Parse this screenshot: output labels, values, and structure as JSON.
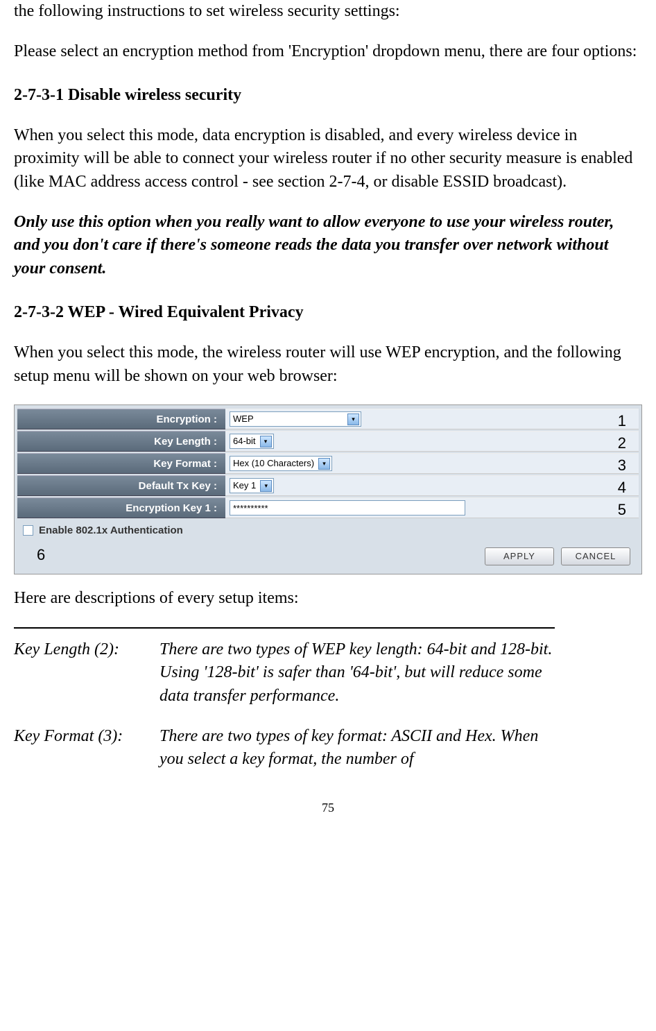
{
  "intro": {
    "line1": "the following instructions to set wireless security settings:",
    "line2": "Please select an encryption method from 'Encryption' dropdown menu, there are four options:"
  },
  "sections": {
    "s1": {
      "heading": "2-7-3-1 Disable wireless security",
      "body": "When you select this mode, data encryption is disabled, and every wireless device in proximity will be able to connect your wireless router if no other security measure is enabled (like MAC address access control - see section 2-7-4, or disable ESSID broadcast).",
      "warning": "Only use this option when you really want to allow everyone to use your wireless router, and you don't care if there's someone reads the data you transfer over network without your consent."
    },
    "s2": {
      "heading": "2-7-3-2 WEP - Wired Equivalent Privacy",
      "body": "When you select this mode, the wireless router will use WEP encryption, and the following setup menu will be shown on your web browser:"
    }
  },
  "ui": {
    "rows": {
      "encryption": {
        "label": "Encryption :",
        "value": "WEP",
        "annot": "1"
      },
      "key_length": {
        "label": "Key Length :",
        "value": "64-bit",
        "annot": "2"
      },
      "key_format": {
        "label": "Key Format :",
        "value": "Hex (10 Characters)",
        "annot": "3"
      },
      "default_tx": {
        "label": "Default Tx Key :",
        "value": "Key 1",
        "annot": "4"
      },
      "enc_key1": {
        "label": "Encryption Key 1 :",
        "value": "**********",
        "annot": "5"
      }
    },
    "checkbox": {
      "label": "Enable 802.1x Authentication",
      "annot": "6"
    },
    "buttons": {
      "apply": "APPLY",
      "cancel": "CANCEL"
    }
  },
  "desc": {
    "intro": "Here are descriptions of every setup items:",
    "items": {
      "key_length": {
        "label": "Key Length (2):",
        "text": "There are two types of WEP key length: 64-bit and 128-bit. Using '128-bit' is safer than '64-bit', but will reduce some data transfer performance."
      },
      "key_format": {
        "label": "Key Format (3):",
        "text": "There are two types of key format: ASCII and Hex. When you select a key format, the number of"
      }
    }
  },
  "page_number": "75"
}
